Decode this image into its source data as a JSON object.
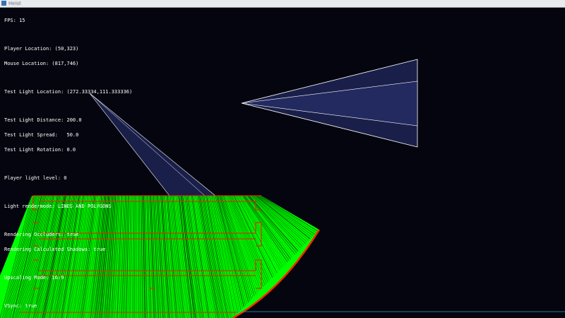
{
  "window": {
    "title": "Heist"
  },
  "hud": {
    "fps": "FPS: 15",
    "player_location": "Player Location: (50,323)",
    "mouse_location": "Mouse Location: (817,746)",
    "test_light_location": "Test Light Location: (272.33334,111.333336)",
    "test_light_distance": "Test Light Distance: 200.0",
    "test_light_spread": "Test Light Spread:   50.0",
    "test_light_rotation": "Test Light Rotation: 0.0",
    "player_light_level": "Player light level: 0",
    "light_rendermode": "Light rendermode: LINES AND POLYGONS",
    "rendering_occluders": "Rendering Occluders: true",
    "rendering_shadows": "Rendering Calculated Shadows: true",
    "upscaling_mode": "Upscaling Mode: 16:9",
    "vsync": "VSync: true"
  },
  "colors": {
    "background": "#05050f",
    "light_fill": "#1a1f4a",
    "shadow_lines": "#00ff00",
    "occluders": "#c83c00",
    "edge": "#ff2a00"
  }
}
